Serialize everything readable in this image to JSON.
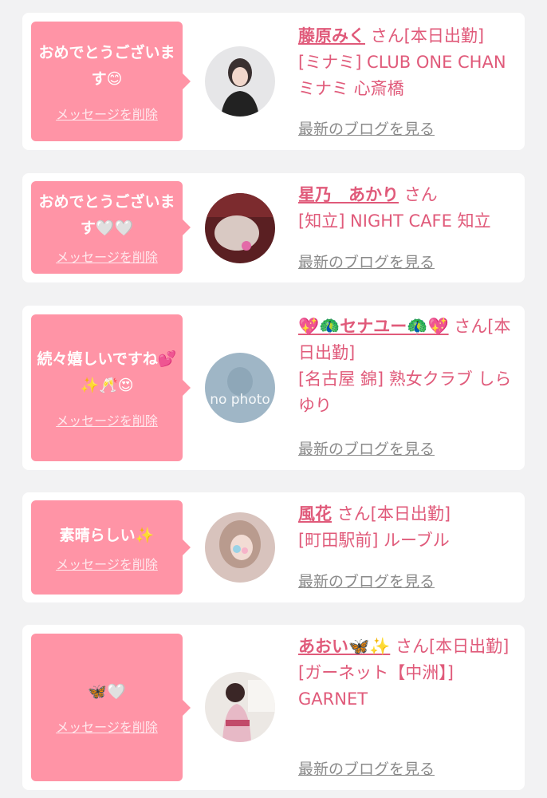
{
  "delete_label": "メッセージを削除",
  "blog_label": "最新のブログを見る",
  "no_photo_label": "no photo",
  "colors": {
    "bubble": "#ff94a6",
    "accent": "#e05a7a",
    "muted": "#8a8a8a",
    "background": "#f2f2f3"
  },
  "cards": [
    {
      "message": "おめでとうございます😊",
      "name": "藤原みく",
      "suffix": "さん[本日出勤]",
      "shop": "[ミナミ] CLUB ONE CHAN ミナミ 心斎橋"
    },
    {
      "message": "おめでとうございます🤍🤍",
      "name": "星乃　あかり",
      "suffix": "さん",
      "shop": "[知立] NIGHT CAFE 知立"
    },
    {
      "message": "続々嬉しいですね💕✨🥂😍",
      "name": "💖🦚セナユー🦚💖",
      "suffix": "さん[本日出勤]",
      "shop": "[名古屋 錦] 熟女クラブ しらゆり"
    },
    {
      "message": "素晴らしい✨",
      "name": "風花",
      "suffix": "さん[本日出勤]",
      "shop": "[町田駅前] ルーブル"
    },
    {
      "message": "🦋🤍",
      "name": "あおい🦋✨",
      "suffix": "さん[本日出勤]",
      "shop": "[ガーネット【中洲】] GARNET"
    }
  ]
}
